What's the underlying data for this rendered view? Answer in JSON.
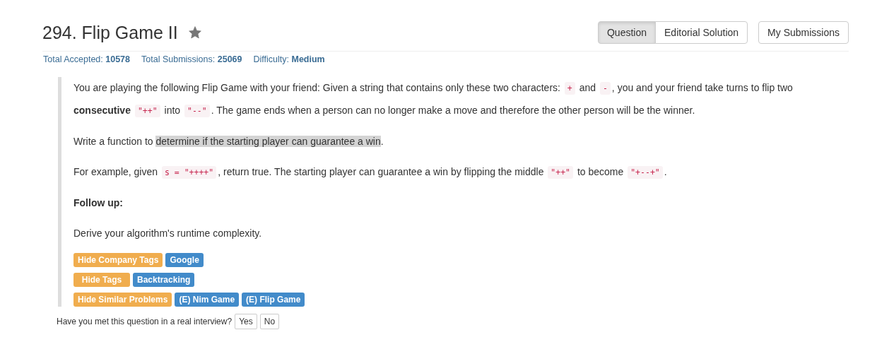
{
  "title": "294. Flip Game II",
  "starred": true,
  "view_tabs": [
    {
      "label": "Question",
      "selected": true
    },
    {
      "label": "Editorial Solution",
      "selected": false
    }
  ],
  "submissions_button": "My Submissions",
  "stats": [
    {
      "label": "Total Accepted:",
      "value": "10578"
    },
    {
      "label": "Total Submissions:",
      "value": "25069"
    },
    {
      "label": "Difficulty:",
      "value": "Medium"
    }
  ],
  "paragraphs": [
    {
      "kind": "text",
      "segments": [
        {
          "kind": "text",
          "text": "You are playing the following Flip Game with your friend: Given a string that contains only these two characters: "
        },
        {
          "kind": "code",
          "text": "+"
        },
        {
          "kind": "text",
          "text": " and "
        },
        {
          "kind": "code",
          "text": "-"
        },
        {
          "kind": "text",
          "text": ", you and your friend take turns to flip two "
        },
        {
          "kind": "bold",
          "text": "consecutive"
        },
        {
          "kind": "code",
          "text": "\"++\""
        },
        {
          "kind": "text",
          "text": " into "
        },
        {
          "kind": "code",
          "text": "\"--\""
        },
        {
          "kind": "text",
          "text": ". The game ends when a person can no longer make a move and therefore the other person will be the winner."
        }
      ]
    },
    {
      "kind": "text",
      "segments": [
        {
          "kind": "text",
          "text": "Write a function to "
        },
        {
          "kind": "highlight",
          "text": "determine if the starting player can guarantee a win"
        },
        {
          "kind": "text",
          "text": "."
        }
      ]
    },
    {
      "kind": "text",
      "segments": [
        {
          "kind": "text",
          "text": "For example, given "
        },
        {
          "kind": "code",
          "text": "s = \"++++\""
        },
        {
          "kind": "text",
          "text": ", return true. The starting player can guarantee a win by flipping the middle "
        },
        {
          "kind": "code",
          "text": "\"++\""
        },
        {
          "kind": "text",
          "text": " to become "
        },
        {
          "kind": "code",
          "text": "\"+--+\""
        },
        {
          "kind": "text",
          "text": "."
        }
      ]
    },
    {
      "kind": "heading",
      "segments": [
        {
          "kind": "text",
          "text": "Follow up:"
        }
      ]
    },
    {
      "kind": "text",
      "segments": [
        {
          "kind": "text",
          "text": "Derive your algorithm's runtime complexity."
        }
      ]
    }
  ],
  "tag_groups": [
    {
      "toggle": "Hide Company Tags",
      "tags": [
        "Google"
      ]
    },
    {
      "toggle": "Hide Tags",
      "tags": [
        "Backtracking"
      ]
    },
    {
      "toggle": "Hide Similar Problems",
      "tags": [
        "(E) Nim Game",
        "(E) Flip Game"
      ]
    }
  ],
  "interview": {
    "question": "Have you met this question in a real interview?",
    "buttons": [
      "Yes",
      "No"
    ]
  }
}
